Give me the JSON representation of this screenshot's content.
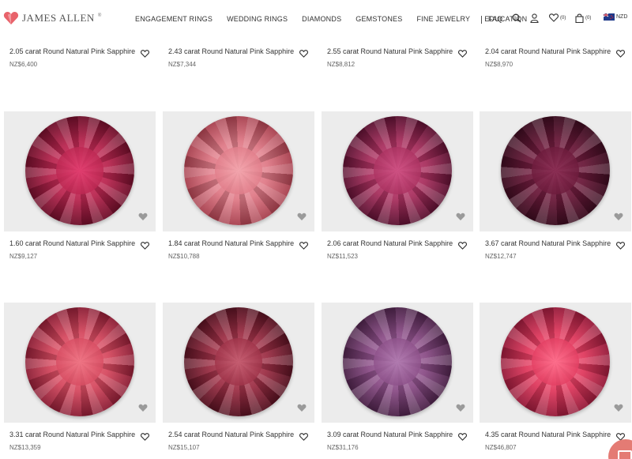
{
  "header": {
    "logo_text": "JAMES ALLEN",
    "logo_mark": "®",
    "nav": [
      "ENGAGEMENT RINGS",
      "WEDDING RINGS",
      "DIAMONDS",
      "GEMSTONES",
      "FINE JEWELRY",
      "EDUCATION"
    ],
    "faq": "FAQ",
    "wishlist_count": "(0)",
    "cart_count": "(0)",
    "currency": "NZD",
    "brand_color": "#e8636b"
  },
  "top_row": [
    {
      "title": "2.05 carat Round Natural Pink Sapphire",
      "price": "NZ$6,400"
    },
    {
      "title": "2.43 carat Round Natural Pink Sapphire",
      "price": "NZ$7,344"
    },
    {
      "title": "2.55 carat Round Natural Pink Sapphire",
      "price": "NZ$8,812"
    },
    {
      "title": "2.04 carat Round Natural Pink Sapphire",
      "price": "NZ$8,970"
    }
  ],
  "products": [
    {
      "title": "1.60 carat Round Natural Pink Sapphire",
      "price": "NZ$9,127",
      "color": "#b8264f",
      "light": "#e23c6e",
      "dark": "#6e0f2a"
    },
    {
      "title": "1.84 carat Round Natural Pink Sapphire",
      "price": "NZ$10,788",
      "color": "#df7a87",
      "light": "#f4a5ad",
      "dark": "#a8414f"
    },
    {
      "title": "2.06 carat Round Natural Pink Sapphire",
      "price": "NZ$11,523",
      "color": "#a8305e",
      "light": "#cf4f82",
      "dark": "#5c1232"
    },
    {
      "title": "3.67 carat Round Natural Pink Sapphire",
      "price": "NZ$12,747",
      "color": "#6a1a3a",
      "light": "#8a2c52",
      "dark": "#3a0c1f"
    },
    {
      "title": "3.31 carat Round Natural Pink Sapphire",
      "price": "NZ$13,359",
      "color": "#d5495f",
      "light": "#f07484",
      "dark": "#8c1e35"
    },
    {
      "title": "2.54 carat Round Natural Pink Sapphire",
      "price": "NZ$15,107",
      "color": "#9b2f45",
      "light": "#c65c70",
      "dark": "#551221"
    },
    {
      "title": "3.09 carat Round Natural Pink Sapphire",
      "price": "NZ$31,176",
      "color": "#8a4d86",
      "light": "#b17ab0",
      "dark": "#4c2349"
    },
    {
      "title": "4.35 carat Round Natural Pink Sapphire",
      "price": "NZ$46,807",
      "color": "#e03a5e",
      "light": "#ff6d8b",
      "dark": "#961b3a"
    }
  ]
}
